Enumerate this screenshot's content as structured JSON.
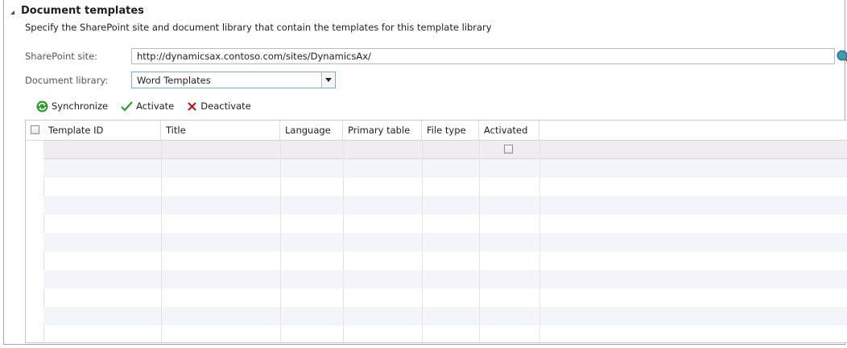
{
  "section": {
    "title": "Document templates",
    "description": "Specify the SharePoint site and document library that contain the templates for this template library"
  },
  "fields": {
    "sharepoint_site_label": "SharePoint site:",
    "sharepoint_site_value": "http://dynamicsax.contoso.com/sites/DynamicsAx/",
    "document_library_label": "Document library:",
    "document_library_value": "Word Templates"
  },
  "toolbar": {
    "synchronize_label": "Synchronize",
    "activate_label": "Activate",
    "deactivate_label": "Deactivate"
  },
  "grid": {
    "columns": [
      "Template ID",
      "Title",
      "Language",
      "Primary table",
      "File type",
      "Activated"
    ],
    "rows": []
  },
  "colors": {
    "accent_green": "#2e9e2e",
    "deactivate_red": "#b01c1c",
    "row_alt": "#f2f6fa",
    "new_row": "#f0ecf0"
  }
}
